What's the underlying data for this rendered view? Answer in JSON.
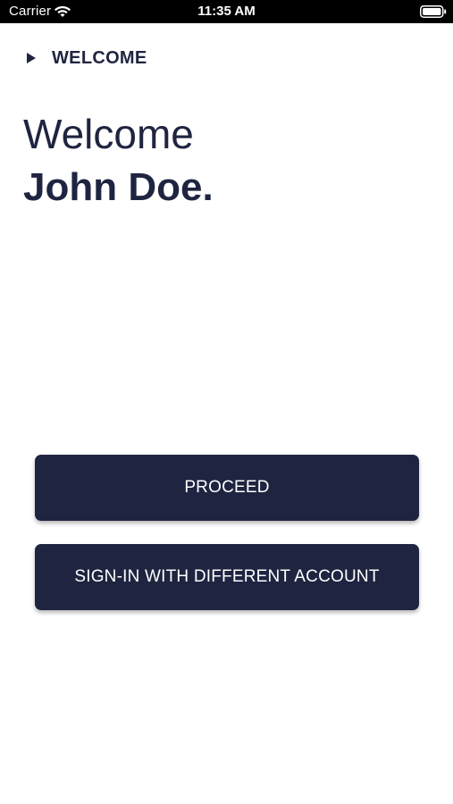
{
  "status_bar": {
    "carrier": "Carrier",
    "time": "11:35 AM",
    "icons": [
      "wifi-icon",
      "battery-icon"
    ]
  },
  "header": {
    "icon": "caret-right-icon",
    "title": "WELCOME"
  },
  "greeting": {
    "line1": "Welcome",
    "line2": "John Doe."
  },
  "actions": {
    "proceed_label": "PROCEED",
    "signin_other_label": "SIGN-IN WITH DIFFERENT ACCOUNT"
  },
  "colors": {
    "primary": "#1f2440",
    "background": "#ffffff",
    "status_bar": "#000000"
  }
}
